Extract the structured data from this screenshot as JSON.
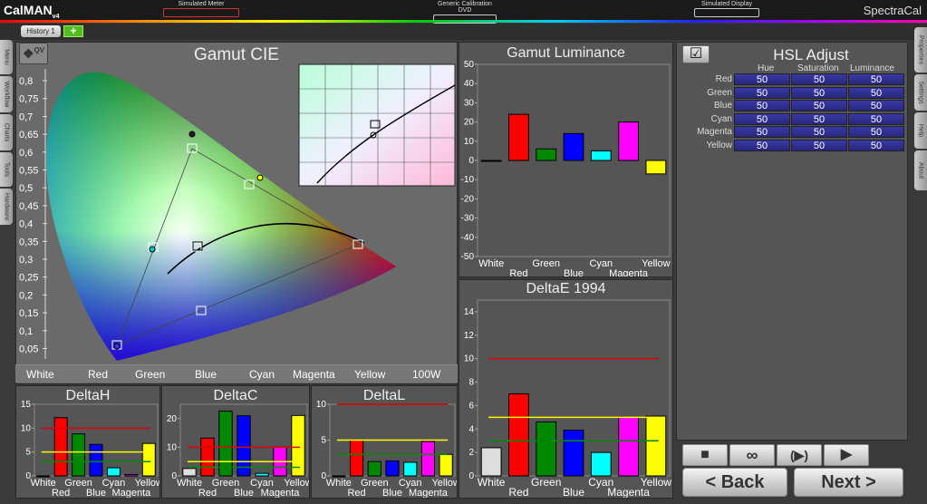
{
  "app": {
    "logo": "CalMAN",
    "logo_version": "v4",
    "brand": "SpectraCal",
    "sources": [
      "Simulated Meter",
      "Generic Calibration DVD",
      "Simulated Display"
    ]
  },
  "tabs": {
    "history": "History 1",
    "add": "+"
  },
  "left_tabs": [
    "Menu",
    "Workflow",
    "Charts",
    "Tools",
    "Hardware"
  ],
  "right_tabs": [
    "Properties",
    "Settings",
    "Help",
    "About"
  ],
  "cie": {
    "title": "Gamut CIE",
    "badge": "QV",
    "y_ticks": [
      "0,8",
      "0,75",
      "0,7",
      "0,65",
      "0,6",
      "0,55",
      "0,5",
      "0,45",
      "0,4",
      "0,35",
      "0,3",
      "0,25",
      "0,2",
      "0,15",
      "0,1",
      "0,05"
    ],
    "legend": [
      "White",
      "Red",
      "Green",
      "Blue",
      "Cyan",
      "Magenta",
      "Yellow",
      "100W"
    ]
  },
  "colors": {
    "white": "#dddddd",
    "red": "#ff0000",
    "green": "#008800",
    "blue": "#0000ff",
    "cyan": "#00ffff",
    "magenta": "#ff00ff",
    "yellow": "#ffff00",
    "ref_red": "#dd0000",
    "ref_yellow": "#ffff00",
    "ref_green": "#008800"
  },
  "chart_data": [
    {
      "id": "gamut_luminance",
      "type": "bar",
      "title": "Gamut Luminance",
      "categories": [
        "White",
        "Red",
        "Green",
        "Blue",
        "Cyan",
        "Magenta",
        "Yellow"
      ],
      "values": [
        0,
        24,
        6,
        14,
        5,
        20,
        -7
      ],
      "ylim": [
        -50,
        50
      ],
      "yticks": [
        "50",
        "40",
        "30",
        "20",
        "10",
        "0",
        "-10",
        "-20",
        "-30",
        "-40",
        "-50"
      ]
    },
    {
      "id": "deltae_1994",
      "type": "bar",
      "title": "DeltaE 1994",
      "categories": [
        "White",
        "Red",
        "Green",
        "Blue",
        "Cyan",
        "Magenta",
        "Yellow"
      ],
      "values": [
        2.4,
        7.0,
        4.6,
        3.9,
        2.0,
        5.0,
        5.1
      ],
      "ylim": [
        0,
        15
      ],
      "yticks": [
        "14",
        "12",
        "10",
        "8",
        "6",
        "4",
        "2",
        "0"
      ],
      "reference_lines": {
        "red": 10,
        "yellow": 5,
        "green": 3
      }
    },
    {
      "id": "deltah",
      "type": "bar",
      "title": "DeltaH",
      "categories": [
        "White",
        "Red",
        "Green",
        "Blue",
        "Cyan",
        "Magenta",
        "Yellow"
      ],
      "values": [
        0,
        12.2,
        8.8,
        6.6,
        1.7,
        0.3,
        6.8
      ],
      "ylim": [
        0,
        15
      ],
      "yticks": [
        "15",
        "10",
        "5",
        "0"
      ],
      "reference_lines": {
        "red": 10,
        "yellow": 5,
        "green": 3
      }
    },
    {
      "id": "deltac",
      "type": "bar",
      "title": "DeltaC",
      "categories": [
        "White",
        "Red",
        "Green",
        "Blue",
        "Cyan",
        "Magenta",
        "Yellow"
      ],
      "values": [
        2.6,
        13.2,
        22.6,
        21.0,
        0.9,
        10.1,
        21.1
      ],
      "ylim": [
        0,
        25
      ],
      "yticks": [
        "20",
        "10",
        "0"
      ],
      "reference_lines": {
        "red": 10,
        "yellow": 5,
        "green": 3
      }
    },
    {
      "id": "deltal",
      "type": "bar",
      "title": "DeltaL",
      "categories": [
        "White",
        "Red",
        "Green",
        "Blue",
        "Cyan",
        "Magenta",
        "Yellow"
      ],
      "values": [
        0,
        5.0,
        2.0,
        2.1,
        1.9,
        4.8,
        3.0
      ],
      "ylim": [
        0,
        10
      ],
      "yticks": [
        "10",
        "5",
        "0"
      ],
      "reference_lines": {
        "red": 10,
        "yellow": 5,
        "green": 3
      }
    }
  ],
  "hsl": {
    "title": "HSL Adjust",
    "columns": [
      "Hue",
      "Saturation",
      "Luminance"
    ],
    "rows": [
      {
        "label": "Red",
        "hue": "50",
        "saturation": "50",
        "luminance": "50"
      },
      {
        "label": "Green",
        "hue": "50",
        "saturation": "50",
        "luminance": "50"
      },
      {
        "label": "Blue",
        "hue": "50",
        "saturation": "50",
        "luminance": "50"
      },
      {
        "label": "Cyan",
        "hue": "50",
        "saturation": "50",
        "luminance": "50"
      },
      {
        "label": "Magenta",
        "hue": "50",
        "saturation": "50",
        "luminance": "50"
      },
      {
        "label": "Yellow",
        "hue": "50",
        "saturation": "50",
        "luminance": "50"
      }
    ]
  },
  "controls": {
    "stop": "■",
    "loop": "∞",
    "play_loop": "(▶)",
    "play": "▶",
    "back": "< Back",
    "next": "Next >"
  }
}
